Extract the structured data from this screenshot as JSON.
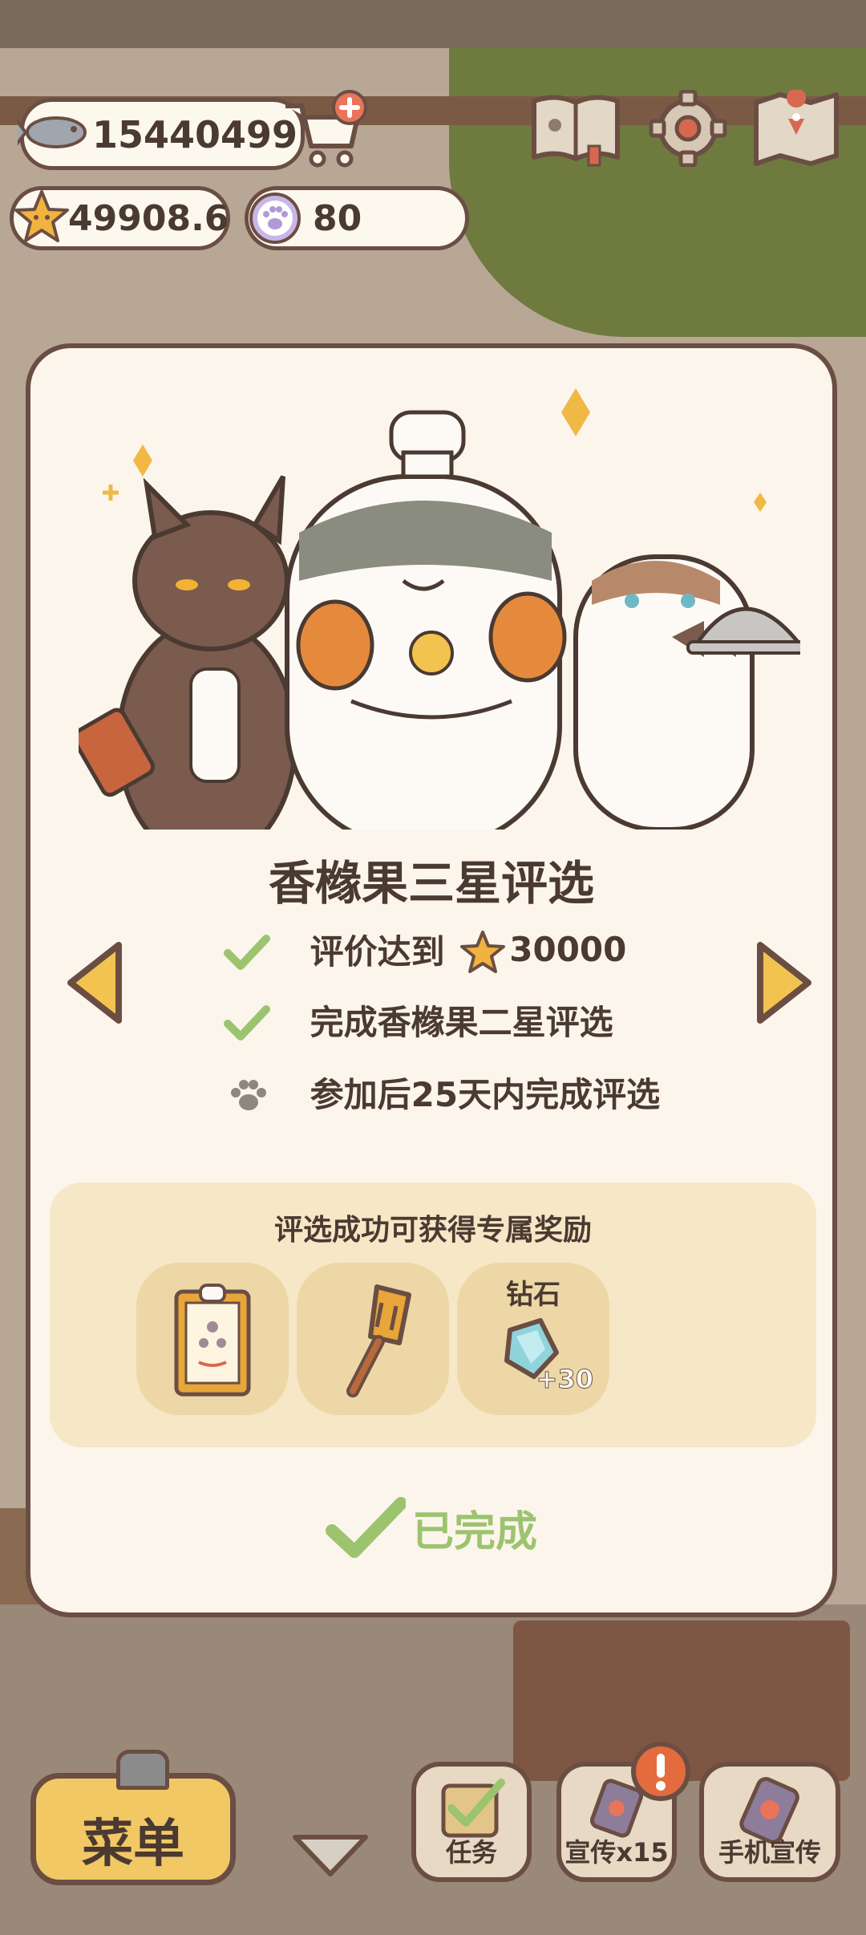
{
  "hud": {
    "fish_count": "15440499",
    "star_rating": "49908.6",
    "paw_tokens": "80"
  },
  "modal": {
    "title": "香橼果三星评选",
    "conditions": [
      {
        "text_before": "评价达到",
        "star_value": "30000",
        "done": true
      },
      {
        "text": "完成香橼果二星评选",
        "done": true
      },
      {
        "text": "参加后25天内完成评选",
        "done": false
      }
    ],
    "reward_title": "评选成功可获得专属奖励",
    "rewards": [
      {
        "icon": "certificate-icon"
      },
      {
        "icon": "spatula-icon"
      },
      {
        "label": "钻石",
        "icon": "diamond-icon",
        "qty": "+30"
      }
    ],
    "status": "已完成"
  },
  "bottom_bar": {
    "menu_label": "菜单",
    "task_label": "任务",
    "promo_label": "宣传x15",
    "phone_promo_label": "手机宣传"
  },
  "colors": {
    "border_brown": "#6b4e43",
    "panel_cream": "#fcf5ec",
    "reward_bg": "#f6e7c6",
    "check_green": "#9cc46f",
    "gold": "#f2c865"
  }
}
